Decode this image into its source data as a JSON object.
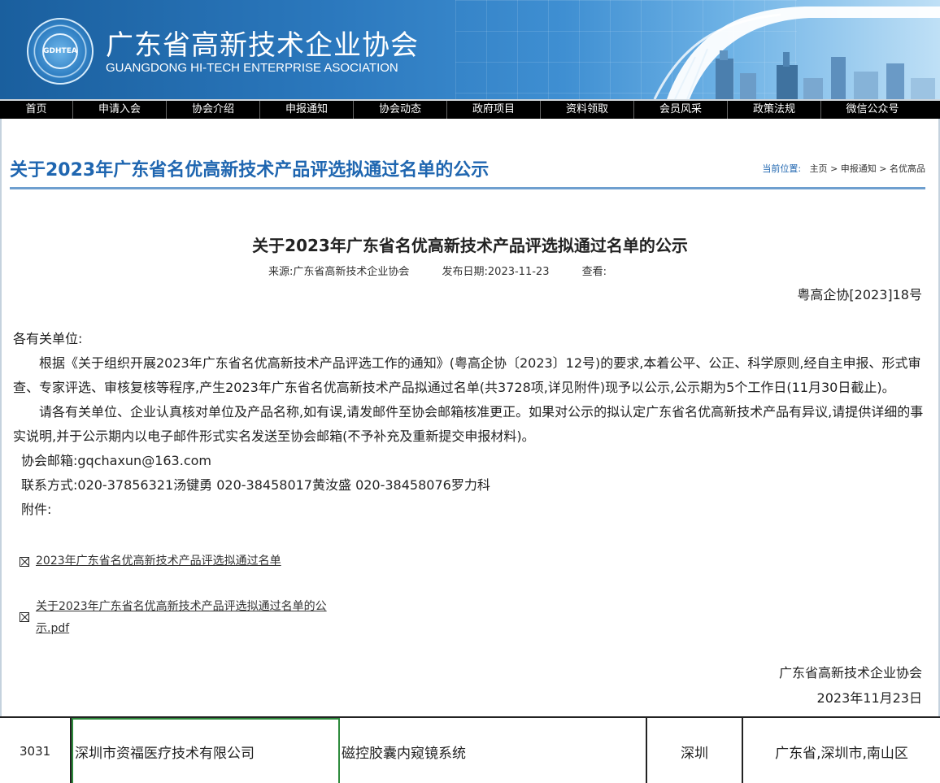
{
  "header": {
    "title": "广东省高新技术企业协会",
    "subtitle": "GUANGDONG HI-TECH ENTERPRISE ASOCIATION",
    "logo_text": "GDHTEA"
  },
  "nav": [
    {
      "label": "首页"
    },
    {
      "label": "申请入会"
    },
    {
      "label": "协会介绍"
    },
    {
      "label": "申报通知"
    },
    {
      "label": "协会动态"
    },
    {
      "label": "政府项目"
    },
    {
      "label": "资料领取"
    },
    {
      "label": "会员风采"
    },
    {
      "label": "政策法规"
    },
    {
      "label": "微信公众号"
    }
  ],
  "page_title": "关于2023年广东省名优高新技术产品评选拟通过名单的公示",
  "breadcrumb": {
    "label": "当前位置:",
    "items": [
      "主页",
      "申报通知",
      "名优高品"
    ],
    "sep": ">"
  },
  "article": {
    "title": "关于2023年广东省名优高新技术产品评选拟通过名单的公示",
    "source": "来源:广东省高新技术企业协会",
    "date": "发布日期:2023-11-23",
    "views": "查看:",
    "doc_no": "粤高企协[2023]18号",
    "greeting": "各有关单位:",
    "para1": "根据《关于组织开展2023年广东省名优高新技术产品评选工作的通知》(粤高企协〔2023〕12号)的要求,本着公平、公正、科学原则,经自主申报、形式审查、专家评选、审核复核等程序,产生2023年广东省名优高新技术产品拟通过名单(共3728项,详见附件)现予以公示,公示期为5个工作日(11月30日截止)。",
    "para2": "请各有关单位、企业认真核对单位及产品名称,如有误,请发邮件至协会邮箱核准更正。如果对公示的拟认定广东省名优高新技术产品有异议,请提供详细的事实说明,并于公示期内以电子邮件形式实名发送至协会邮箱(不予补充及重新提交申报材料)。",
    "email": "协会邮箱:gqchaxun@163.com",
    "contact": "联系方式:020-37856321汤键勇   020-38458017黄汝盛  020-38458076罗力科",
    "attachments_label": "附件:",
    "attachment1": "2023年广东省名优高新技术产品评选拟通过名单",
    "attachment2_line1": "关于2023年广东省名优高新技术产品评选拟通过名单的公",
    "attachment2_line2": "示.pdf",
    "sign_org": "广东省高新技术企业协会",
    "sign_date": "2023年11月23日"
  },
  "table_row": {
    "no": "3031",
    "company": "深圳市资福医疗技术有限公司",
    "product": "磁控胶囊内窥镜系统",
    "city": "深圳",
    "region": "广东省,深圳市,南山区"
  }
}
